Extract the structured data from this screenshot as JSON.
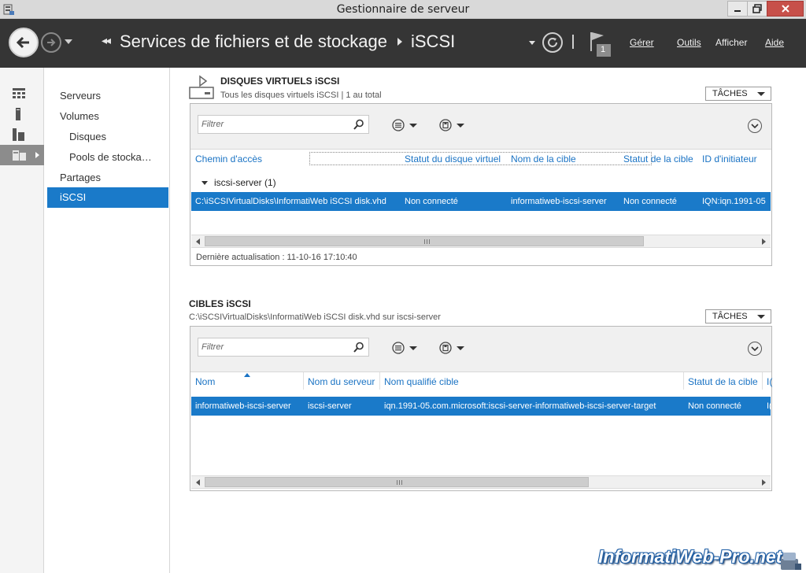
{
  "window": {
    "title": "Gestionnaire de serveur"
  },
  "header": {
    "breadcrumb": [
      "Services de fichiers et de stockage",
      "iSCSI"
    ],
    "notifications_count": "1",
    "menu": [
      "Gérer",
      "Outils",
      "Afficher",
      "Aide"
    ]
  },
  "nav": {
    "items": [
      "Serveurs",
      "Volumes",
      "Disques",
      "Pools de stocka…",
      "Partages",
      "iSCSI"
    ],
    "active": "iSCSI"
  },
  "virtual_disks": {
    "title": "DISQUES VIRTUELS iSCSI",
    "subtitle": "Tous les disques virtuels iSCSI | 1 au total",
    "tasks_label": "TÂCHES",
    "filter_placeholder": "Filtrer",
    "columns": [
      "Chemin d'accès",
      "Statut du disque virtuel",
      "Nom de la cible",
      "Statut de la cible",
      "ID d'initiateur"
    ],
    "group": "iscsi-server (1)",
    "rows": [
      [
        "C:\\iSCSIVirtualDisks\\InformatiWeb iSCSI disk.vhd",
        "Non connecté",
        "informatiweb-iscsi-server",
        "Non connecté",
        "IQN:iqn.1991-05"
      ]
    ],
    "last_update": "Dernière actualisation : 11-10-16 17:10:40"
  },
  "targets": {
    "title": "CIBLES iSCSI",
    "subtitle": "C:\\iSCSIVirtualDisks\\InformatiWeb iSCSI disk.vhd sur iscsi-server",
    "tasks_label": "TÂCHES",
    "filter_placeholder": "Filtrer",
    "columns": [
      "Nom",
      "Nom du serveur",
      "Nom qualifié cible",
      "Statut de la cible",
      "I("
    ],
    "rows": [
      [
        "informatiweb-iscsi-server",
        "iscsi-server",
        "iqn.1991-05.com.microsoft:iscsi-server-informatiweb-iscsi-server-target",
        "Non connecté",
        "I("
      ]
    ]
  },
  "watermark": "InformatiWeb-Pro.net",
  "colors": {
    "selection": "#1a7ac9",
    "header_bg": "#353535",
    "link": "#1a73c4"
  }
}
